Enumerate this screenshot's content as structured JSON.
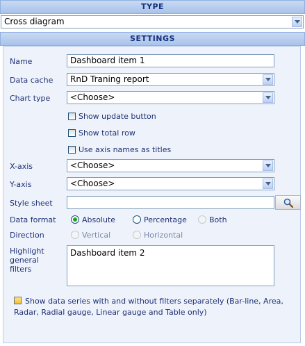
{
  "type_section": {
    "header": "TYPE",
    "selected": "Cross diagram"
  },
  "settings_section": {
    "header": "SETTINGS"
  },
  "fields": {
    "name": {
      "label": "Name",
      "value": "Dashboard item 1"
    },
    "data_cache": {
      "label": "Data cache",
      "value": "RnD Traning report"
    },
    "chart_type": {
      "label": "Chart type",
      "value": "<Choose>"
    },
    "x_axis": {
      "label": "X-axis",
      "value": "<Choose>"
    },
    "y_axis": {
      "label": "Y-axis",
      "value": "<Choose>"
    },
    "style_sheet": {
      "label": "Style sheet",
      "value": ""
    },
    "data_format": {
      "label": "Data format",
      "options": [
        "Absolute",
        "Percentage",
        "Both"
      ],
      "selected": "Absolute"
    },
    "direction": {
      "label": "Direction",
      "options": [
        "Vertical",
        "Horizontal"
      ]
    },
    "highlight_filters": {
      "label_line1": "Highlight",
      "label_line2": "general",
      "label_line3": "filters",
      "value": "Dashboard item 2"
    }
  },
  "checkboxes": {
    "show_update_button": "Show update button",
    "show_total_row": "Show total row",
    "use_axis_names": "Use axis names as titles"
  },
  "footnote": {
    "line1": "Show data series with and without filters separately (Bar-line, Area,",
    "line2": "Radar, Radial gauge, Linear gauge and Table only)"
  },
  "icons": {
    "search": "magnifier-icon",
    "dropdown": "chevron-down-icon"
  },
  "colors": {
    "header_bg": "#b6cdee",
    "header_text": "#15317e",
    "panel_bg": "#eef3fb",
    "label_text": "#1f2f75",
    "radio_selected": "#21a121"
  }
}
